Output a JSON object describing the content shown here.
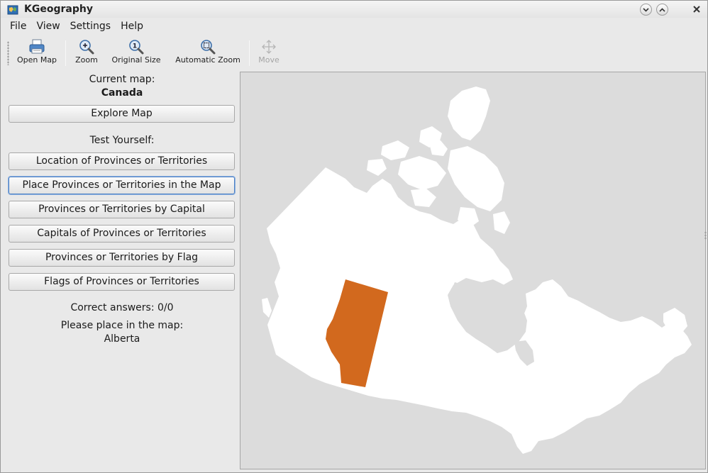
{
  "window": {
    "title": "KGeography"
  },
  "menu": {
    "items": [
      "File",
      "View",
      "Settings",
      "Help"
    ]
  },
  "toolbar": {
    "open_map": "Open Map",
    "zoom": "Zoom",
    "original_size": "Original Size",
    "automatic_zoom": "Automatic Zoom",
    "move": "Move"
  },
  "panel": {
    "current_map_label": "Current map:",
    "current_map_name": "Canada",
    "explore_button": "Explore Map",
    "test_heading": "Test Yourself:",
    "tests": [
      "Location of Provinces or Territories",
      "Place Provinces or Territories in the Map",
      "Provinces or Territories by Capital",
      "Capitals of Provinces or Territories",
      "Provinces or Territories by Flag",
      "Flags of Provinces or Territories"
    ],
    "correct_answers": "Correct answers: 0/0",
    "prompt": "Please place in the map:",
    "target_region": "Alberta"
  },
  "colors": {
    "map_land": "#ffffff",
    "map_water": "#dcdcdc",
    "highlight": "#d2691e",
    "focus_border": "#4a7fc4"
  },
  "icons": {
    "app": "kgeography-icon",
    "open_map": "printer-open-icon",
    "zoom": "zoom-in-icon",
    "original_size": "zoom-original-icon",
    "automatic_zoom": "zoom-fit-icon",
    "move": "move-arrows-icon"
  }
}
